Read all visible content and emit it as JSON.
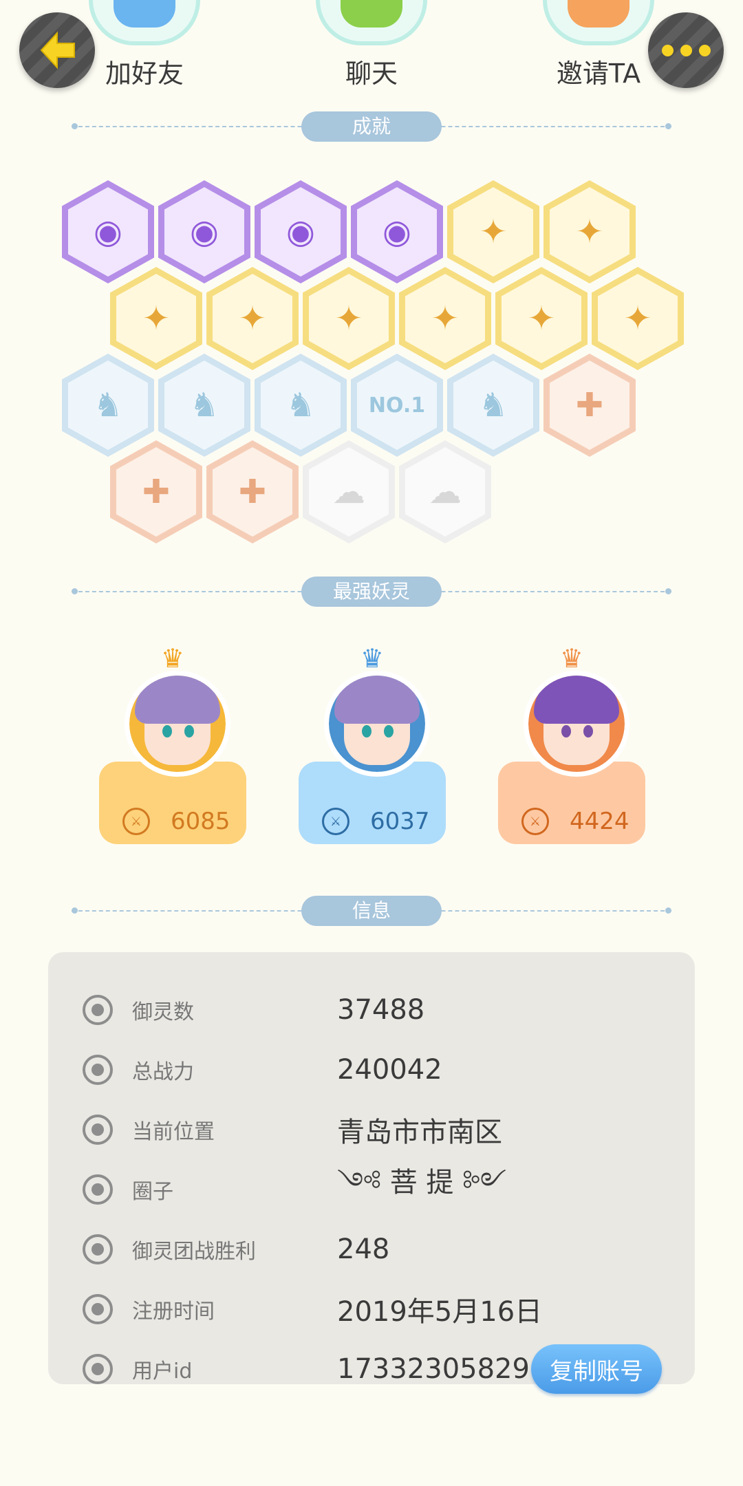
{
  "top_actions": [
    {
      "label": "加好友"
    },
    {
      "label": "聊天"
    },
    {
      "label": "邀请TA"
    }
  ],
  "sections": {
    "achievements": "成就",
    "strongest": "最强妖灵",
    "info": "信息"
  },
  "badges": {
    "row1": [
      "purple",
      "purple",
      "purple",
      "purple",
      "gold",
      "gold"
    ],
    "row2": [
      "gold",
      "gold",
      "gold",
      "gold",
      "gold",
      "gold"
    ],
    "row3": [
      "blue",
      "blue",
      "blue",
      "blue",
      "blue",
      "peach"
    ],
    "row4": [
      "peach",
      "peach",
      "grey",
      "grey"
    ],
    "no1_text": "NO.1"
  },
  "strongest_spirits": [
    {
      "power": "6085"
    },
    {
      "power": "6037"
    },
    {
      "power": "4424"
    }
  ],
  "info": {
    "rows": [
      {
        "label": "御灵数",
        "value": "37488"
      },
      {
        "label": "总战力",
        "value": "240042"
      },
      {
        "label": "当前位置",
        "value": "青岛市市南区"
      },
      {
        "label": "圈子",
        "value": "༺ 菩 提 ༻"
      },
      {
        "label": "御灵团战胜利",
        "value": "248"
      },
      {
        "label": "注册时间",
        "value": "2019年5月16日"
      },
      {
        "label": "用户id",
        "value": "17332305829"
      }
    ],
    "copy_button": "复制账号"
  },
  "colors": {
    "background": "#fdfcf3",
    "accent_blue": "#4a9be8",
    "section_pill": "#a8c6dc"
  }
}
